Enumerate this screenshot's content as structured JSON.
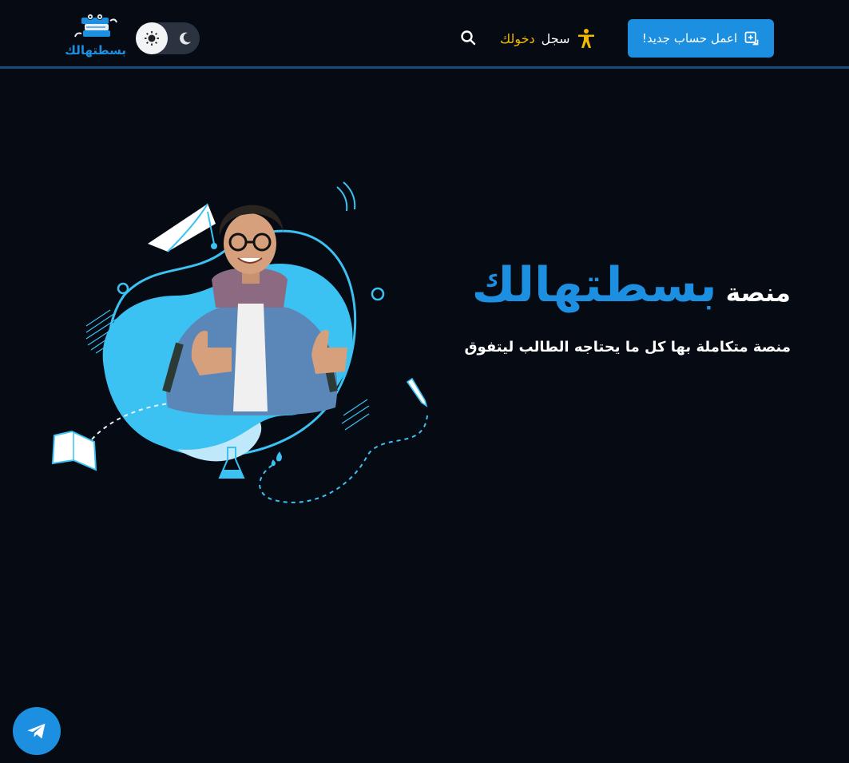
{
  "nav": {
    "register_label": "اعمل حساب جديد!",
    "login_word1": "سجل",
    "login_word2": "دخولك",
    "logo_text": "بسطتهالك",
    "icons": {
      "register": "add-user-icon",
      "login": "accessibility-person-icon",
      "search": "search-icon",
      "theme_light": "sun-icon",
      "theme_dark": "moon-icon"
    }
  },
  "hero": {
    "title_small": "منصة",
    "title_big": "بسطتهالك",
    "subtitle": "منصة متكاملة بها كل ما يحتاجه الطالب ليتفوق"
  },
  "floating": {
    "telegram_icon": "telegram-icon"
  },
  "colors": {
    "background": "#050a13",
    "accent": "#1d8fe0",
    "highlight": "#f5b800",
    "blob": "#3bc2f2"
  }
}
